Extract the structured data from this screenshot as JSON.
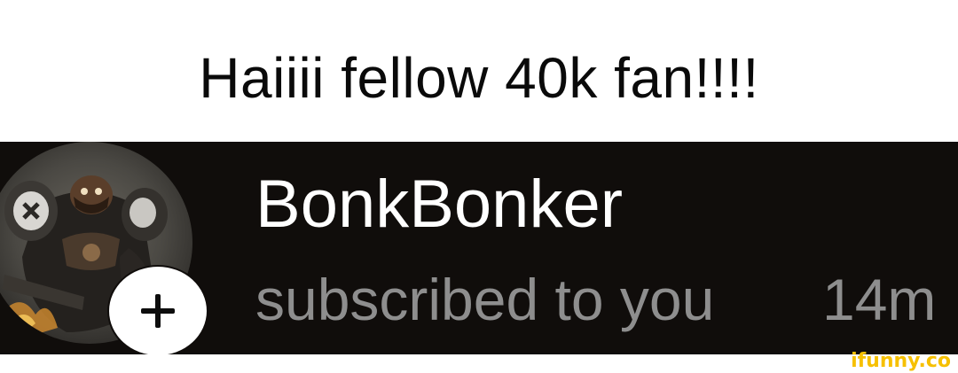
{
  "caption": {
    "text": "Haiiii fellow 40k fan!!!!"
  },
  "notification": {
    "username": "BonkBonker",
    "message": "subscribed to you",
    "time": "14m",
    "avatar_icon": "space-marine-avatar-icon",
    "add_icon": "plus-icon"
  },
  "watermark": {
    "text": "ifunny.co"
  },
  "colors": {
    "caption_background": "#ffffff",
    "notification_background": "#100d0b",
    "username": "#ffffff",
    "message": "#8e8e8e",
    "watermark": "#f6c000"
  }
}
